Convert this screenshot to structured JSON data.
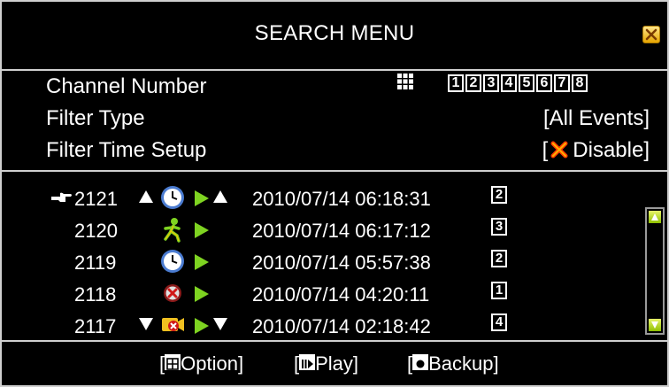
{
  "window": {
    "title": "SEARCH MENU"
  },
  "settings": {
    "channel_number": {
      "label": "Channel Number",
      "channels": [
        "1",
        "2",
        "3",
        "4",
        "5",
        "6",
        "7",
        "8"
      ]
    },
    "filter_type": {
      "label": "Filter Type",
      "value": "[All Events]"
    },
    "filter_time_setup": {
      "label": "Filter Time Setup",
      "bracket_open": "[",
      "value": "Disable]"
    }
  },
  "events": [
    {
      "id": "2121",
      "datetime": "2010/07/14 06:18:31",
      "channel": "2",
      "type_icon": "clock-icon",
      "selected": true,
      "arrows": "up"
    },
    {
      "id": "2120",
      "datetime": "2010/07/14 06:17:12",
      "channel": "3",
      "type_icon": "motion-icon",
      "selected": false,
      "arrows": "none"
    },
    {
      "id": "2119",
      "datetime": "2010/07/14 05:57:38",
      "channel": "2",
      "type_icon": "clock-icon",
      "selected": false,
      "arrows": "none"
    },
    {
      "id": "2118",
      "datetime": "2010/07/14 04:20:11",
      "channel": "1",
      "type_icon": "alarm-icon",
      "selected": false,
      "arrows": "none"
    },
    {
      "id": "2117",
      "datetime": "2010/07/14 02:18:42",
      "channel": "4",
      "type_icon": "video-loss-icon",
      "selected": false,
      "arrows": "down"
    }
  ],
  "footer": {
    "option": {
      "open": "[",
      "label": "Option]"
    },
    "play": {
      "open": "[",
      "label": "Play]"
    },
    "backup": {
      "open": "[",
      "label": "Backup]"
    }
  },
  "colors": {
    "background": "#000000",
    "border": "#cfcfcf",
    "accent_green": "#7ed321",
    "close_yellow": "#f5c400"
  }
}
